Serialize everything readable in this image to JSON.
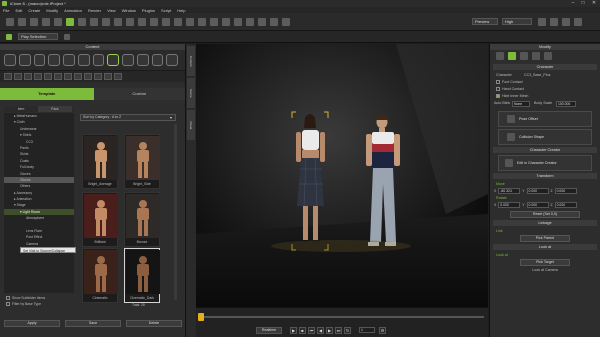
{
  "title_bar": {
    "title": "iClone 8 - (macro)role.iProject *",
    "minimize": "–",
    "maximize": "□",
    "close": "✕"
  },
  "menu": [
    "File",
    "Edit",
    "Create",
    "Modify",
    "Animation",
    "Render",
    "View",
    "Window",
    "Plugins",
    "Script",
    "Help"
  ],
  "toolbar": {
    "preview_label": "Preview",
    "quality_label": "High"
  },
  "toolbar2": {
    "play_selection_label": "Play Selection"
  },
  "content": {
    "title": "Content",
    "tabs": {
      "template": "Template",
      "custom": "Custom"
    },
    "tree_header": {
      "item": "Item",
      "pack": "Pack"
    },
    "sort_label": "Sort by Category : A to Z",
    "tree": [
      {
        "label": "▸ MetaHumans",
        "indent": 0
      },
      {
        "label": "▾ Cloth",
        "indent": 0
      },
      {
        "label": "Underwear",
        "indent": 1
      },
      {
        "label": "▾ Shirts",
        "indent": 1
      },
      {
        "label": "CC3",
        "indent": 2
      },
      {
        "label": "Pants",
        "indent": 1
      },
      {
        "label": "Skirts",
        "indent": 1
      },
      {
        "label": "Coats",
        "indent": 1
      },
      {
        "label": "Full-body",
        "indent": 1
      },
      {
        "label": "Gloves",
        "indent": 1
      },
      {
        "label": "Gloves",
        "indent": 1
      },
      {
        "label": "Others",
        "indent": 1
      },
      {
        "label": "▸ Accessory",
        "indent": 0
      },
      {
        "label": "▸ Animation",
        "indent": 0
      },
      {
        "label": "▾ Stage",
        "indent": 0
      },
      {
        "label": "▾ Light Room",
        "indent": 1
      },
      {
        "label": "Atmosphere",
        "indent": 2
      },
      {
        "label": "Set Visit to Source/Collapse",
        "indent": 2
      },
      {
        "label": "Lens Flare",
        "indent": 2
      },
      {
        "label": "Post Effect",
        "indent": 2
      },
      {
        "label": "Camera",
        "indent": 2
      },
      {
        "label": "Image Layer",
        "indent": 2
      }
    ],
    "tooltip": "Set Visit to Source/Collapse",
    "thumbs": [
      {
        "label": "Bright_Average",
        "skin": "#c9956c",
        "bg": "#2a2522"
      },
      {
        "label": "Bright_Side",
        "skin": "#b5845e",
        "bg": "#3a2f2a"
      },
      {
        "label": "Brilliant",
        "skin": "#c28b66",
        "bg": "#4a1e1a"
      },
      {
        "label": "Bronze",
        "skin": "#a97653",
        "bg": "#2e2a28"
      },
      {
        "label": "Cinematic",
        "skin": "#9c6a48",
        "bg": "#3a221a"
      },
      {
        "label": "Cinematic_Dark",
        "skin": "#8c5e40",
        "bg": "#141414"
      }
    ],
    "check1": "Show Subfolder Items",
    "check2": "Filter by Base Type",
    "total": "Total: 25",
    "apply": "Apply",
    "save": "Save",
    "delete": "Delete"
  },
  "strip": [
    "Content",
    "Scene",
    "Visual"
  ],
  "viewport": {},
  "timeline": {
    "realtime": "Realtime",
    "frame": "1"
  },
  "modify": {
    "title": "Modify",
    "character_section": "Character",
    "character_label": "Character",
    "character_value": "CC3_Base_Plus",
    "foot_contact": "Foot Contact",
    "hand_contact": "Hand Contact",
    "hide_inner_mesh": "Hide Inner Mesh",
    "auto_blink_label": "Auto Blink",
    "auto_blink_value": "None",
    "body_scale_label": "Body Scale",
    "body_scale_value": "100.000",
    "pose_offset": "Pose Offset",
    "collision_shape": "Collision Shape",
    "char_creator_section": "Character Creator",
    "edit_in_cc": "Edit in Character Creator",
    "transform_section": "Transform",
    "move_label": "Move",
    "move": {
      "x": "-80.324",
      "y": "0.000",
      "z": "0.000"
    },
    "rotate_label": "Rotate",
    "rotate": {
      "x": "0.000",
      "y": "0.000",
      "z": "0.000"
    },
    "reset_label": "Reset (Set 0,0)",
    "linkage_section": "Linkage",
    "link_label": "Link",
    "pick_parent": "Pick Parent",
    "lookat_section": "Look at",
    "lookat_label": "Look at",
    "pick_target": "Pick Target",
    "lookat_camera": "Look at Camera"
  },
  "colors": {
    "accent_green": "#7dbb3a",
    "timeline_knob": "#e6b01c"
  }
}
